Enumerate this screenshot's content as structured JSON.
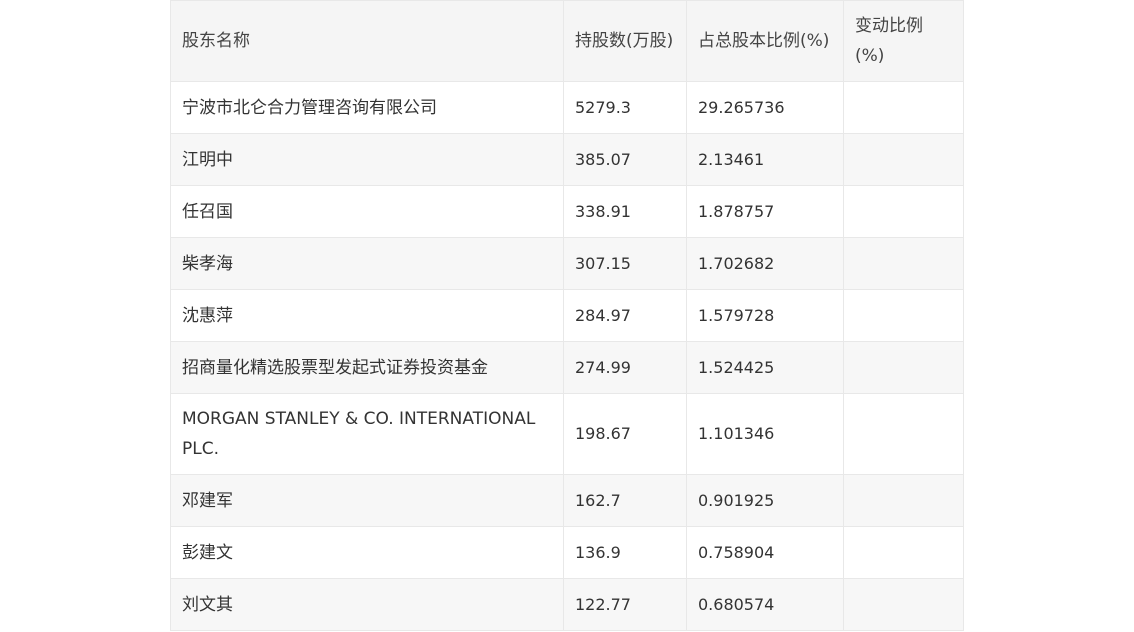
{
  "table": {
    "headers": [
      "股东名称",
      "持股数(万股)",
      "占总股本比例(%)",
      "变动比例(%)"
    ],
    "rows": [
      {
        "name": "宁波市北仑合力管理咨询有限公司",
        "shares": "5279.3",
        "ratio": "29.265736",
        "change": ""
      },
      {
        "name": "江明中",
        "shares": "385.07",
        "ratio": "2.13461",
        "change": ""
      },
      {
        "name": "任召国",
        "shares": "338.91",
        "ratio": "1.878757",
        "change": ""
      },
      {
        "name": "柴孝海",
        "shares": "307.15",
        "ratio": "1.702682",
        "change": ""
      },
      {
        "name": "沈惠萍",
        "shares": "284.97",
        "ratio": "1.579728",
        "change": ""
      },
      {
        "name": "招商量化精选股票型发起式证券投资基金",
        "shares": "274.99",
        "ratio": "1.524425",
        "change": ""
      },
      {
        "name": "MORGAN STANLEY & CO. INTERNATIONAL PLC.",
        "shares": "198.67",
        "ratio": "1.101346",
        "change": ""
      },
      {
        "name": "邓建军",
        "shares": "162.7",
        "ratio": "0.901925",
        "change": ""
      },
      {
        "name": "彭建文",
        "shares": "136.9",
        "ratio": "0.758904",
        "change": ""
      },
      {
        "name": "刘文其",
        "shares": "122.77",
        "ratio": "0.680574",
        "change": ""
      }
    ]
  }
}
